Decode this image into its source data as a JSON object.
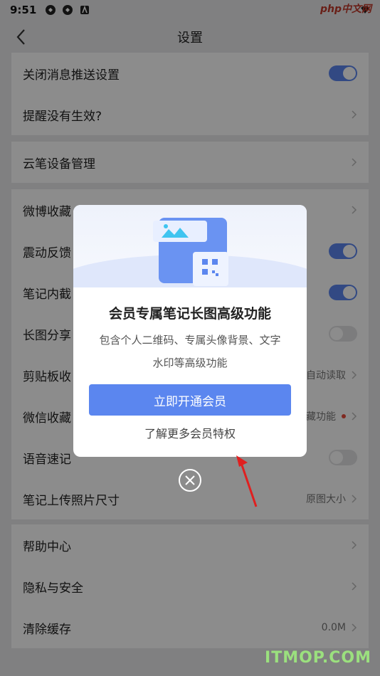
{
  "status_bar": {
    "time": "9:51"
  },
  "watermark_top": "php中文网",
  "watermark_bottom": "ITMOP.COM",
  "header": {
    "title": "设置"
  },
  "groups": [
    {
      "rows": [
        {
          "label": "关闭消息推送设置",
          "control": "toggle-on"
        },
        {
          "label": "提醒没有生效?",
          "control": "chevron"
        }
      ]
    },
    {
      "rows": [
        {
          "label": "云笔设备管理",
          "control": "chevron"
        }
      ]
    },
    {
      "rows": [
        {
          "label": "微博收藏",
          "control": "chevron"
        },
        {
          "label": "震动反馈",
          "control": "toggle-on"
        },
        {
          "label": "笔记内截",
          "control": "toggle-on"
        },
        {
          "label": "长图分享",
          "control": "toggle-off"
        },
        {
          "label": "剪贴板收",
          "value": "自动读取",
          "control": "chevron"
        },
        {
          "label": "微信收藏",
          "value": "藏功能",
          "control": "chevron-dot"
        },
        {
          "label": "语音速记",
          "control": "toggle-off"
        },
        {
          "label": "笔记上传照片尺寸",
          "value": "原图大小",
          "control": "chevron"
        }
      ]
    },
    {
      "rows": [
        {
          "label": "帮助中心",
          "control": "chevron"
        },
        {
          "label": "隐私与安全",
          "control": "chevron"
        },
        {
          "label": "清除缓存",
          "value": "0.0M",
          "control": "chevron"
        }
      ]
    }
  ],
  "dialog": {
    "title": "会员专属笔记长图高级功能",
    "desc_line1": "包含个人二维码、专属头像背景、文字",
    "desc_line2": "水印等高级功能",
    "primary_button": "立即开通会员",
    "link": "了解更多会员特权"
  },
  "colors": {
    "accent": "#5b86ef",
    "overlay": "rgba(0,0,0,0.45)",
    "dot": "#e74c3c"
  }
}
